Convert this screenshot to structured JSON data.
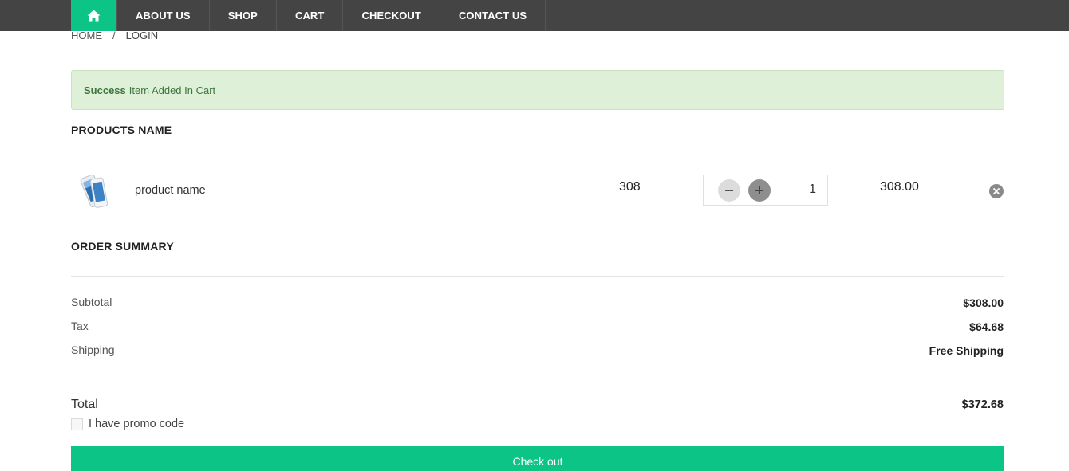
{
  "nav": {
    "home_icon": "home-icon",
    "items": [
      "ABOUT US",
      "SHOP",
      "CART",
      "CHECKOUT",
      "CONTACT US"
    ]
  },
  "breadcrumb": {
    "items": [
      "HOME",
      "LOGIN"
    ],
    "separator": "/"
  },
  "alert": {
    "strong": "Success",
    "message": "Item Added In Cart"
  },
  "products": {
    "title": "PRODUCTS NAME",
    "item": {
      "name": "product name",
      "price": "308",
      "quantity": "1",
      "total": "308.00",
      "image_icon": "phone-product-icon"
    }
  },
  "summary": {
    "title": "ORDER SUMMARY",
    "subtotal_label": "Subtotal",
    "subtotal_value": "$308.00",
    "tax_label": "Tax",
    "tax_value": "$64.68",
    "shipping_label": "Shipping",
    "shipping_value": "Free Shipping",
    "total_label": "Total",
    "total_value": "$372.68",
    "promo_label": "I have promo code",
    "checkout_label": "Check out"
  },
  "colors": {
    "accent": "#0cc485",
    "navbar": "#444444",
    "alert_bg": "#dff0d8",
    "alert_text": "#3c763d"
  }
}
